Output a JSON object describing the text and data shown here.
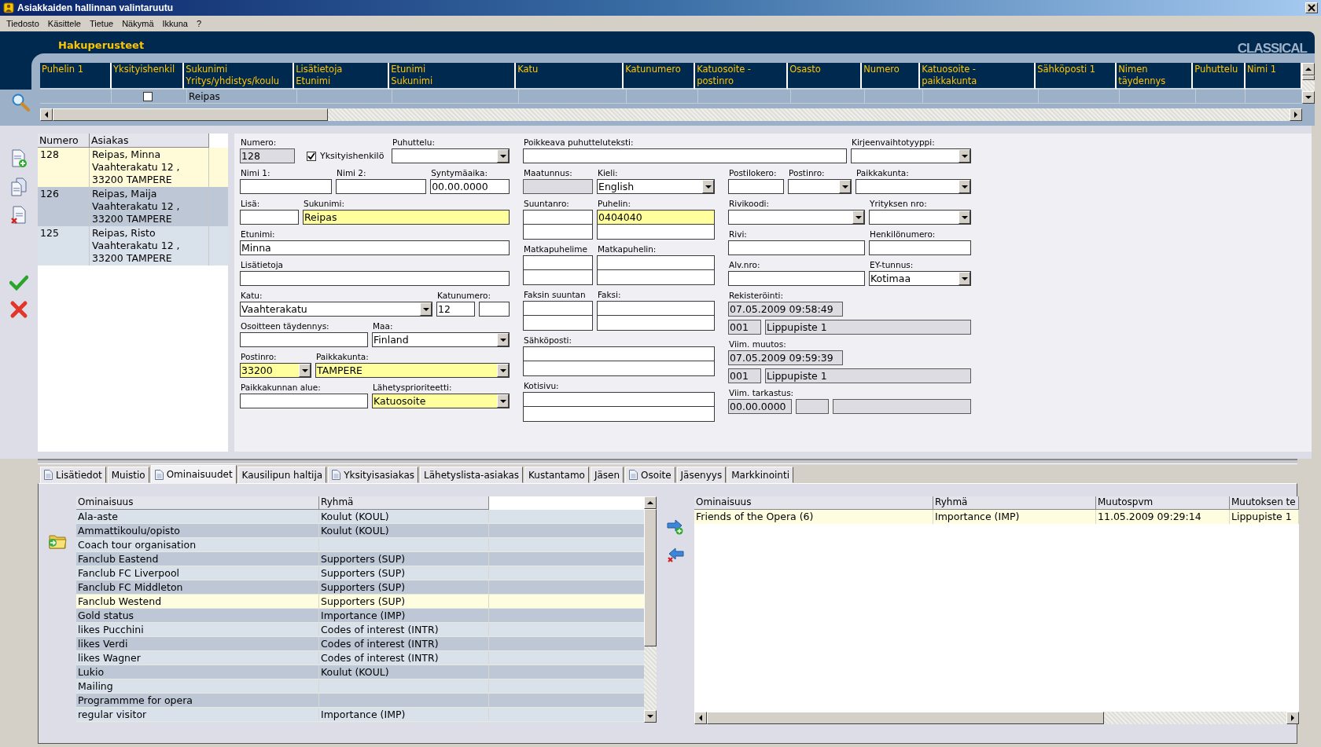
{
  "window": {
    "title": "Asiakkaiden hallinnan valintaruutu"
  },
  "menu": [
    "Tiedosto",
    "Käsittele",
    "Tietue",
    "Näkymä",
    "Ikkuna",
    "?"
  ],
  "search": {
    "title": "Hakuperusteet",
    "logo": "CLASSICAL",
    "columns": [
      {
        "lines": [
          "Puhelin 1"
        ]
      },
      {
        "lines": [
          "Yksityishenkil"
        ],
        "filter_checked": false
      },
      {
        "lines": [
          "Sukunimi",
          "Yritys/yhdistys/koulu"
        ],
        "filter": "Reipas"
      },
      {
        "lines": [
          "Lisätietoja",
          "Etunimi"
        ]
      },
      {
        "lines": [
          "Etunimi",
          "Sukunimi"
        ]
      },
      {
        "lines": [
          "Katu"
        ]
      },
      {
        "lines": [
          "Katunumero"
        ]
      },
      {
        "lines": [
          "Katuosoite -",
          "postinro"
        ]
      },
      {
        "lines": [
          "Osasto"
        ]
      },
      {
        "lines": [
          "Numero"
        ]
      },
      {
        "lines": [
          "Katuosoite -",
          "paikkakunta"
        ]
      },
      {
        "lines": [
          "Sähköposti 1"
        ]
      },
      {
        "lines": [
          "Nimen",
          "täydennys"
        ]
      },
      {
        "lines": [
          "Puhuttelu"
        ]
      },
      {
        "lines": [
          "Nimi 1"
        ]
      }
    ]
  },
  "customers": {
    "columns": [
      "Numero",
      "Asiakas"
    ],
    "rows": [
      {
        "numero": "128",
        "lines": [
          "Reipas, Minna",
          "Vaahterakatu 12 ,",
          "33200 TAMPERE"
        ],
        "selected": true
      },
      {
        "numero": "126",
        "lines": [
          "Reipas, Maija",
          "Vaahterakatu 12 ,",
          "33200 TAMPERE"
        ],
        "selected": false
      },
      {
        "numero": "125",
        "lines": [
          "Reipas, Risto",
          "Vaahterakatu 12 ,",
          "33200 TAMPERE"
        ],
        "selected": false
      }
    ]
  },
  "form": {
    "sections": [
      [
        [
          {
            "label": "Numero:",
            "kind": "text",
            "value": "128",
            "readonly": true,
            "required": false
          },
          {
            "kind": "checkbox",
            "label": "Yksityishenkilö",
            "checked": true
          },
          {
            "label": "Puhuttelu:",
            "kind": "select",
            "readonly": false,
            "required": false
          }
        ],
        [
          {
            "label": "Nimi 1:",
            "kind": "text",
            "readonly": false,
            "required": false
          },
          {
            "label": "Nimi 2:",
            "kind": "text",
            "readonly": false,
            "required": false
          },
          {
            "label": "Syntymäaika:",
            "kind": "text",
            "value": "00.00.0000",
            "readonly": false,
            "required": false
          }
        ],
        [
          {
            "label": "Lisä:",
            "kind": "text",
            "readonly": false,
            "required": false
          },
          {
            "label": "Sukunimi:",
            "kind": "text",
            "value": "Reipas",
            "readonly": false,
            "required": true
          }
        ],
        [
          {
            "label": "Etunimi:",
            "kind": "text",
            "value": "Minna",
            "readonly": false,
            "required": false
          }
        ],
        [
          {
            "label": "Lisätietoja",
            "kind": "text",
            "readonly": false,
            "required": false
          }
        ],
        [
          {
            "label": "Katu:",
            "kind": "select",
            "value": "Vaahterakatu",
            "readonly": false,
            "required": false
          },
          {
            "label": "Katunumero:",
            "kind": "text",
            "value": "12",
            "readonly": false,
            "required": false
          },
          {
            "kind": "text",
            "readonly": false,
            "required": false
          }
        ],
        [
          {
            "label": "Osoitteen täydennys:",
            "kind": "text",
            "readonly": false,
            "required": false
          },
          {
            "label": "Maa:",
            "kind": "select",
            "value": "Finland",
            "readonly": false,
            "required": false
          }
        ],
        [
          {
            "label": "Postinro:",
            "kind": "select",
            "value": "33200",
            "readonly": false,
            "required": true
          },
          {
            "label": "Paikkakunta:",
            "kind": "select",
            "value": "TAMPERE",
            "readonly": false,
            "required": true
          }
        ],
        [
          {
            "label": "Paikkakunnan alue:",
            "kind": "text",
            "readonly": false,
            "required": false
          },
          {
            "label": "Lähetysprioriteetti:",
            "kind": "select",
            "value": "Katuosoite",
            "readonly": false,
            "required": true
          }
        ]
      ],
      [
        [
          {
            "label": "Poikkeava puhutteluteksti:",
            "kind": "text",
            "readonly": false,
            "required": false
          },
          {
            "label": "Kirjeenvaihtotyyppi:",
            "kind": "select",
            "readonly": false,
            "required": false
          }
        ]
      ],
      [
        [
          {
            "label": "Maatunnus:",
            "kind": "text",
            "readonly": true,
            "required": false
          },
          {
            "label": "Kieli:",
            "kind": "select",
            "value": "English",
            "readonly": false,
            "required": false
          }
        ],
        [
          {
            "label": "Suuntanro:",
            "kind": "double",
            "readonly": false,
            "required": false
          },
          {
            "label": "Puhelin:",
            "kind": "double",
            "value": "0404040",
            "readonly": false,
            "required": true
          }
        ],
        [
          {
            "label": "Matkapuhelime",
            "kind": "double",
            "readonly": false,
            "required": false
          },
          {
            "label": "Matkapuhelin:",
            "kind": "double",
            "readonly": false,
            "required": false
          }
        ],
        [
          {
            "label": "Faksin suuntan",
            "kind": "double",
            "readonly": false,
            "required": false
          },
          {
            "label": "Faksi:",
            "kind": "double",
            "readonly": false,
            "required": false
          }
        ],
        [
          {
            "label": "Sähköposti:",
            "kind": "double",
            "readonly": false,
            "required": false
          }
        ],
        [
          {
            "label": "Kotisivu:",
            "kind": "double",
            "readonly": false,
            "required": false
          }
        ]
      ],
      [
        [
          {
            "label": "Postilokero:",
            "kind": "text",
            "readonly": false,
            "required": false
          },
          {
            "label": "Postinro:",
            "kind": "select",
            "readonly": false,
            "required": false
          },
          {
            "label": "Paikkakunta:",
            "kind": "select",
            "readonly": false,
            "required": false
          }
        ],
        [
          {
            "label": "Rivikoodi:",
            "kind": "select",
            "readonly": false,
            "required": false
          },
          {
            "label": "Yrityksen nro:",
            "kind": "select",
            "readonly": false,
            "required": false
          }
        ],
        [
          {
            "label": "Rivi:",
            "kind": "text",
            "readonly": false,
            "required": false
          },
          {
            "label": "Henkilönumero:",
            "kind": "text",
            "readonly": false,
            "required": false
          }
        ],
        [
          {
            "label": "Alv.nro:",
            "kind": "text",
            "readonly": false,
            "required": false
          },
          {
            "label": "EY-tunnus:",
            "kind": "select",
            "value": "Kotimaa",
            "readonly": false,
            "required": false
          }
        ],
        [
          {
            "label": "Rekisteröinti:",
            "kind": "text",
            "value": "07.05.2009 09:58:49",
            "readonly": true,
            "required": false
          }
        ],
        [
          {
            "kind": "text",
            "value": "001",
            "readonly": true,
            "required": false
          },
          {
            "kind": "text",
            "value": "Lippupiste 1",
            "readonly": true,
            "required": false
          }
        ],
        [
          {
            "label": "Viim. muutos:",
            "kind": "text",
            "value": "07.05.2009 09:59:39",
            "readonly": true,
            "required": false
          }
        ],
        [
          {
            "kind": "text",
            "value": "001",
            "readonly": true,
            "required": false
          },
          {
            "kind": "text",
            "value": "Lippupiste 1",
            "readonly": true,
            "required": false
          }
        ],
        [
          {
            "label": "Viim. tarkastus:",
            "kind": "text",
            "value": "00.00.0000",
            "readonly": true,
            "required": false
          },
          {
            "kind": "text",
            "readonly": true,
            "required": false
          },
          {
            "kind": "text",
            "readonly": true,
            "required": false
          }
        ]
      ]
    ]
  },
  "tabs": [
    {
      "label": "Lisätiedot",
      "icon": true,
      "selected": false
    },
    {
      "label": "Muistio",
      "icon": false,
      "selected": false
    },
    {
      "label": "Ominaisuudet",
      "icon": true,
      "selected": true
    },
    {
      "label": "Kausilipun haltija",
      "icon": false,
      "selected": false
    },
    {
      "label": "Yksityisasiakas",
      "icon": true,
      "selected": false
    },
    {
      "label": "Lähetyslista-asiakas",
      "icon": false,
      "selected": false
    },
    {
      "label": "Kustantamo",
      "icon": false,
      "selected": false
    },
    {
      "label": "Jäsen",
      "icon": false,
      "selected": false
    },
    {
      "label": "Osoite",
      "icon": true,
      "selected": false
    },
    {
      "label": "Jäsenyys",
      "icon": false,
      "selected": false
    },
    {
      "label": "Markkinointi",
      "icon": false,
      "selected": false
    }
  ],
  "properties": {
    "columns": [
      "Ominaisuus",
      "Ryhmä"
    ],
    "rows": [
      {
        "name": "Ala-aste",
        "group": "Koulut (KOUL)",
        "selected": false
      },
      {
        "name": "Ammattikoulu/opisto",
        "group": "Koulut (KOUL)",
        "selected": false
      },
      {
        "name": "Coach tour organisation",
        "selected": false
      },
      {
        "name": "Fanclub Eastend",
        "group": "Supporters (SUP)",
        "selected": false
      },
      {
        "name": "Fanclub FC Liverpool",
        "group": "Supporters (SUP)",
        "selected": false
      },
      {
        "name": "Fanclub FC Middleton",
        "group": "Supporters (SUP)",
        "selected": false
      },
      {
        "name": "Fanclub Westend",
        "group": "Supporters (SUP)",
        "selected": true
      },
      {
        "name": "Gold status",
        "group": "Importance (IMP)",
        "selected": false
      },
      {
        "name": "likes Pucchini",
        "group": "Codes of interest (INTR)",
        "selected": false
      },
      {
        "name": "likes Verdi",
        "group": "Codes of interest (INTR)",
        "selected": false
      },
      {
        "name": "likes Wagner",
        "group": "Codes of interest (INTR)",
        "selected": false
      },
      {
        "name": "Lukio",
        "group": "Koulut (KOUL)",
        "selected": false
      },
      {
        "name": "Mailing",
        "selected": false
      },
      {
        "name": "Programmme for opera",
        "selected": false
      },
      {
        "name": "regular visitor",
        "group": "Importance (IMP)",
        "selected": false
      }
    ]
  },
  "assigned": {
    "columns": [
      "Ominaisuus",
      "Ryhmä",
      "Muutospvm",
      "Muutoksen te"
    ],
    "rows": [
      {
        "cells": [
          "Friends of the Opera (6)",
          "Importance (IMP)",
          "11.05.2009 09:29:14",
          "Lippupiste 1"
        ],
        "selected": true
      }
    ]
  }
}
